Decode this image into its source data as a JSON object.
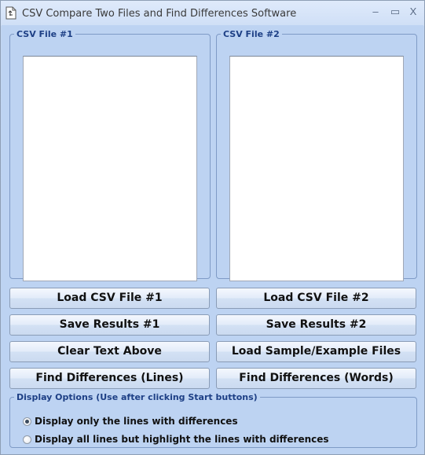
{
  "window": {
    "title": "CSV Compare Two Files and Find Differences Software",
    "icon": "document-icon",
    "controls": {
      "minimize": "–",
      "maximize": "▭",
      "close": "X"
    }
  },
  "file1": {
    "legend": "CSV File #1",
    "content": ""
  },
  "file2": {
    "legend": "CSV File #2",
    "content": ""
  },
  "buttons": {
    "load1": "Load CSV File #1",
    "load2": "Load CSV File #2",
    "save1": "Save Results #1",
    "save2": "Save Results #2",
    "clear": "Clear Text Above",
    "sample": "Load Sample/Example Files",
    "find_lines": "Find Differences (Lines)",
    "find_words": "Find Differences (Words)"
  },
  "display_options": {
    "legend": "Display Options (Use after clicking Start buttons)",
    "options": [
      {
        "label": "Display only the lines with differences",
        "selected": true
      },
      {
        "label": "Display all lines but highlight the lines with differences",
        "selected": false
      }
    ]
  }
}
